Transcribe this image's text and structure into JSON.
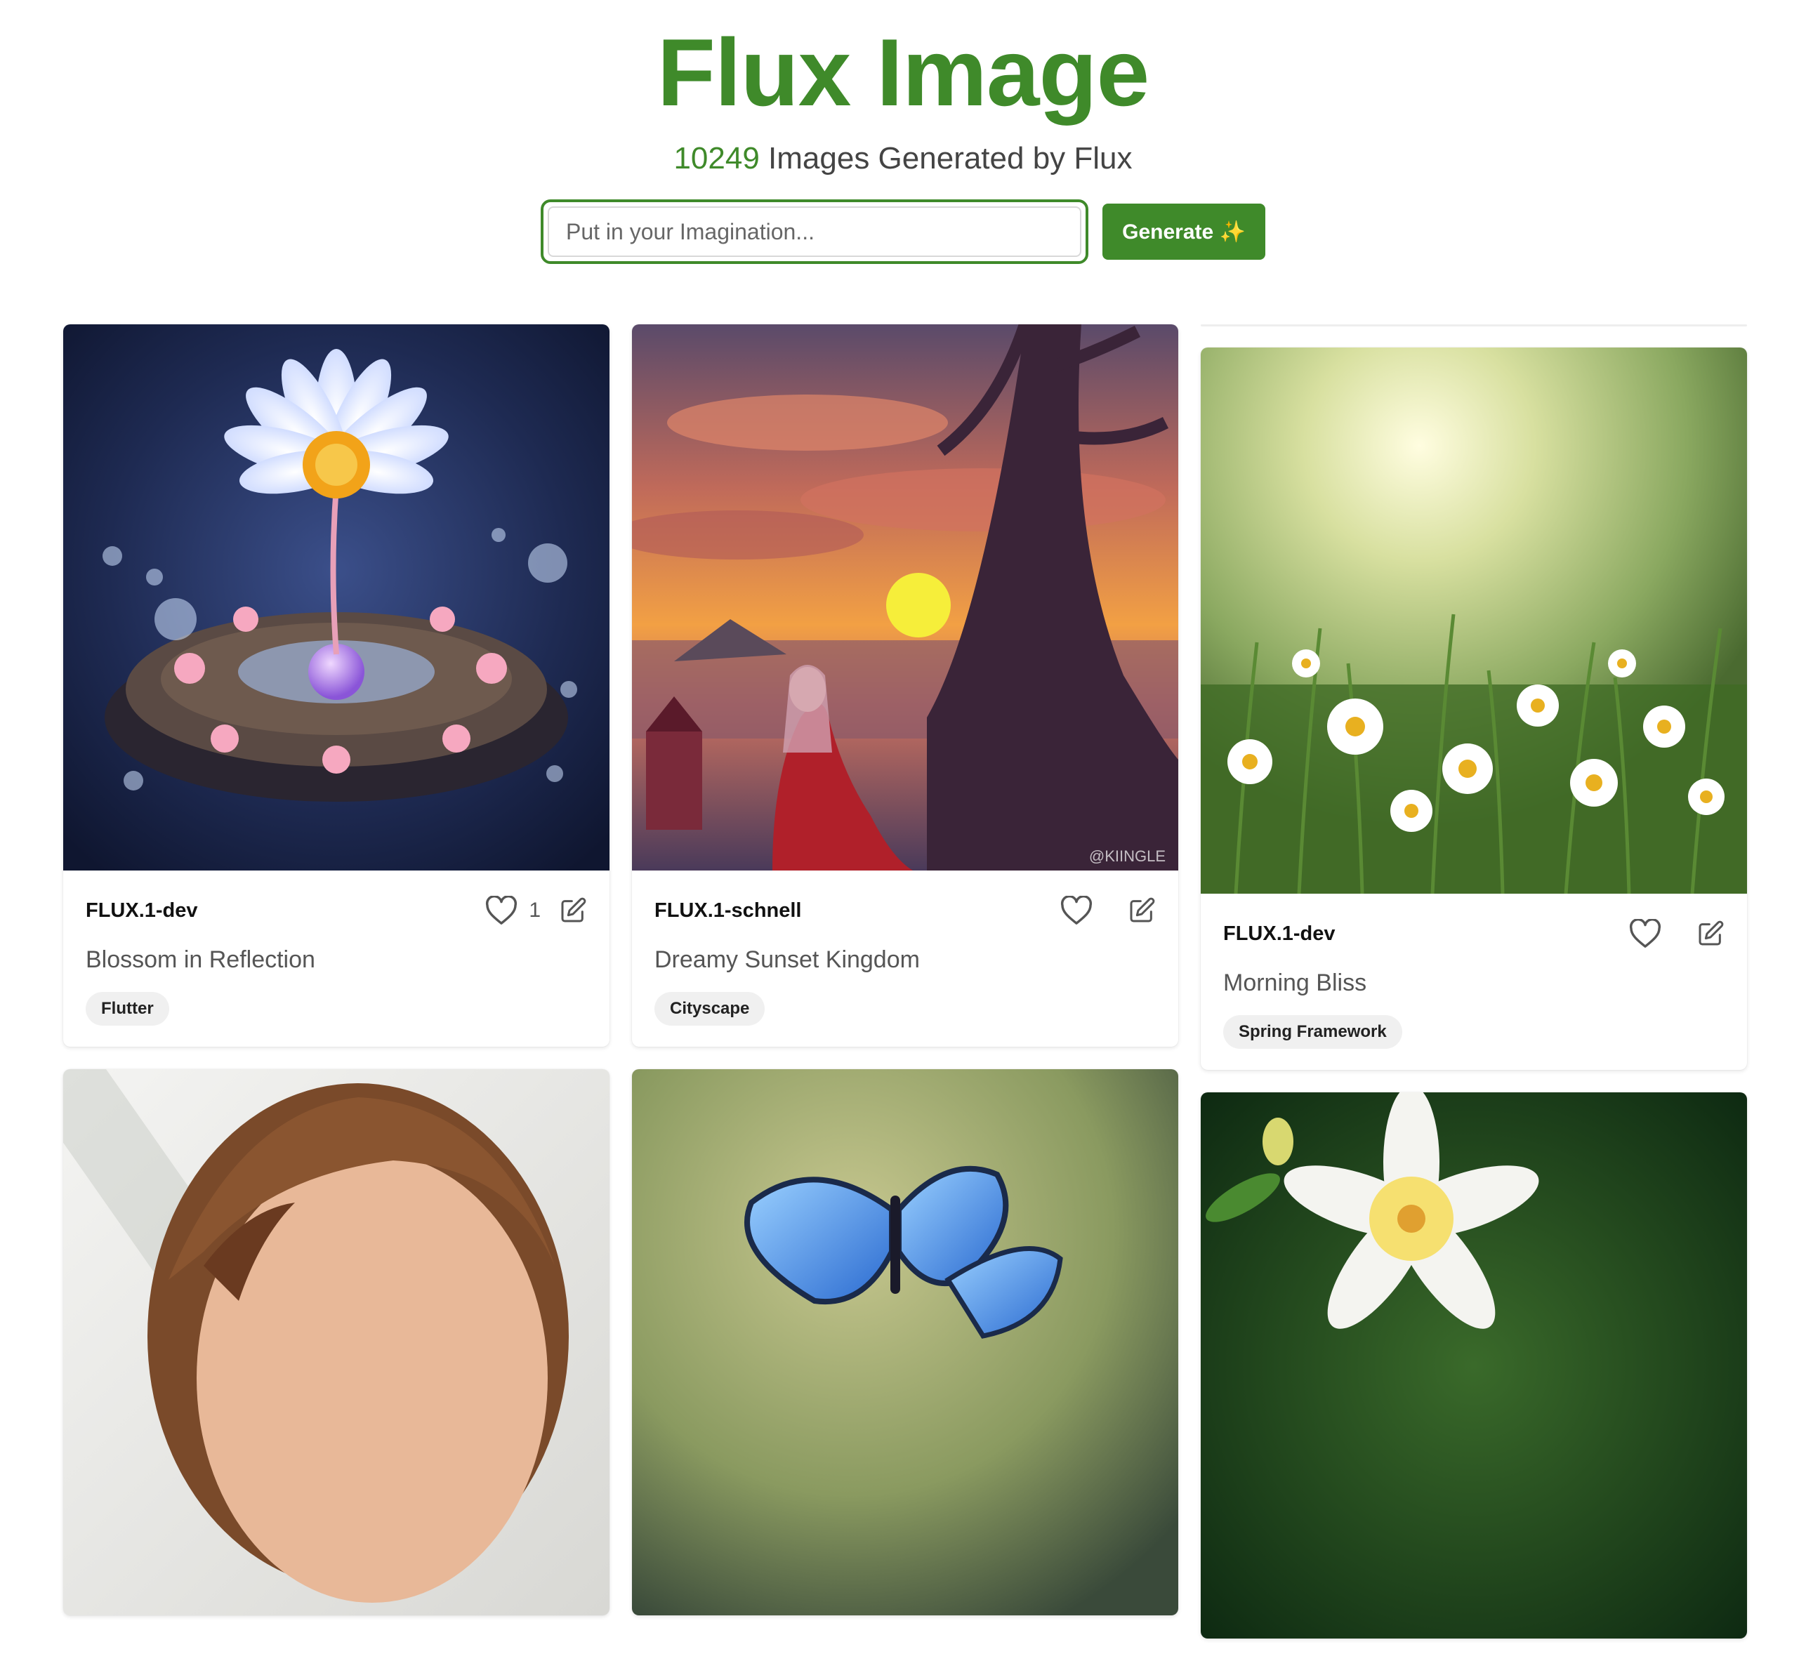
{
  "header": {
    "title": "Flux Image",
    "count": "10249",
    "subtitle_rest": " Images Generated by Flux"
  },
  "search": {
    "placeholder": "Put in your Imagination...",
    "button_label": "Generate ✨"
  },
  "colors": {
    "brand": "#3f8a2a"
  },
  "cards": [
    {
      "model": "FLUX.1-dev",
      "title": "Blossom in Reflection",
      "tag": "Flutter",
      "likes": "1",
      "image": "daisy-nest-bubbles"
    },
    {
      "model": "FLUX.1-schnell",
      "title": "Dreamy Sunset Kingdom",
      "tag": "Cityscape",
      "likes": "",
      "image": "sunset-princess-tree",
      "watermark": "@KIINGLE"
    },
    {
      "model": "FLUX.1-dev",
      "title": "Morning Bliss",
      "tag": "Spring Framework",
      "likes": "",
      "image": "daisy-meadow-sunlight"
    },
    {
      "image": "woman-portrait"
    },
    {
      "image": "blue-butterfly"
    },
    {
      "image": "white-lily-flower"
    }
  ],
  "icons": {
    "like": "heart-icon",
    "edit": "edit-icon",
    "sparkle": "sparkles-icon"
  }
}
